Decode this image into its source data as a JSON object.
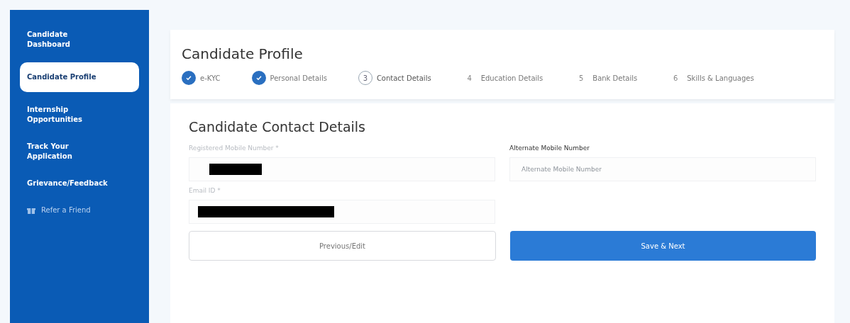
{
  "sidebar": {
    "items": [
      {
        "label": "Candidate Dashboard",
        "selected": false
      },
      {
        "label": "Candidate Profile",
        "selected": true
      },
      {
        "label": "Internship Opportunities",
        "selected": false
      },
      {
        "label": "Track Your Application",
        "selected": false
      },
      {
        "label": "Grievance/Feedback",
        "selected": false
      },
      {
        "label": "Refer a Friend",
        "selected": false,
        "kind": "icon"
      }
    ]
  },
  "profile": {
    "title": "Candidate Profile",
    "steps": [
      {
        "label": "e-KYC",
        "completed": true,
        "current": false
      },
      {
        "label": "Personal Details",
        "completed": true,
        "current": false
      },
      {
        "number": "3",
        "label": "Contact Details",
        "completed": false,
        "current": true
      },
      {
        "number": "4",
        "label": "Education Details",
        "completed": false,
        "current": false
      },
      {
        "number": "5",
        "label": "Bank Details",
        "completed": false,
        "current": false
      },
      {
        "number": "6",
        "label": "Skills & Languages",
        "completed": false,
        "current": false
      }
    ]
  },
  "form": {
    "title": "Candidate Contact Details",
    "fields": [
      {
        "label": "Registered Mobile Number *",
        "disabled": true,
        "redacted": true
      },
      {
        "label": "Alternate Mobile Number",
        "placeholder": "Alternate Mobile Number",
        "disabled": false,
        "redacted": false
      },
      {
        "label": "Email ID *",
        "disabled": true,
        "redacted": true
      }
    ],
    "buttons": [
      {
        "label": "Previous/Edit",
        "kind": "secondary"
      },
      {
        "label": "Save & Next",
        "kind": "primary"
      }
    ]
  }
}
